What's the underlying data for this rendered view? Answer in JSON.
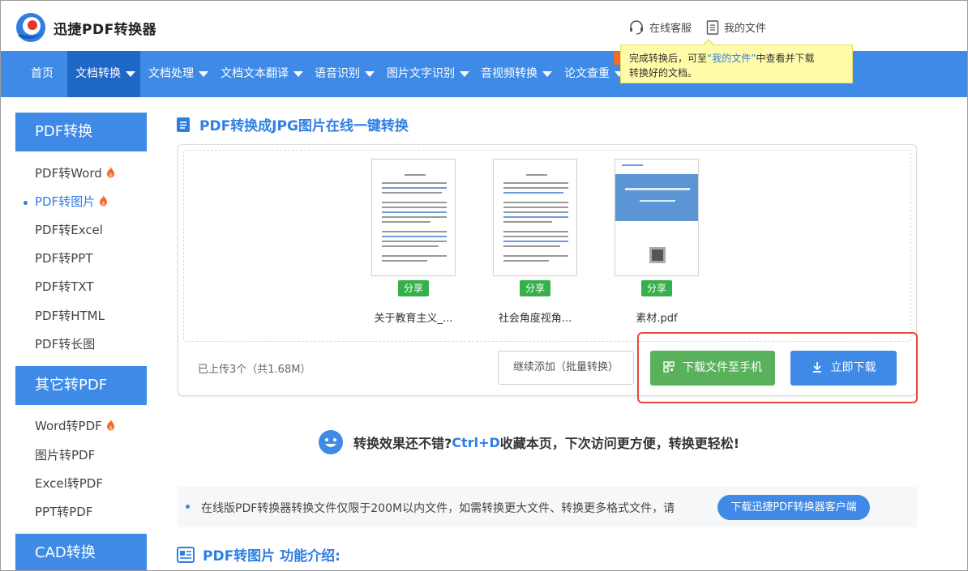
{
  "header": {
    "logo_text": "迅捷PDF转换器",
    "service_label": "在线客服",
    "files_label": "我的文件"
  },
  "nav": {
    "items": [
      {
        "label": "首页"
      },
      {
        "label": "文档转换"
      },
      {
        "label": "文档处理"
      },
      {
        "label": "文档文本翻译"
      },
      {
        "label": "语音识别"
      },
      {
        "label": "图片文字识别"
      },
      {
        "label": "音视频转换"
      },
      {
        "label": "论文查重"
      }
    ]
  },
  "tooltip": {
    "line1_a": "完成转换后，可至",
    "line1_link": "“我的文件”",
    "line1_b": "中查看并下载",
    "line2": "转换好的文档。"
  },
  "sidebar": {
    "sections": [
      {
        "title": "PDF转换",
        "items": [
          "PDF转Word",
          "PDF转图片",
          "PDF转Excel",
          "PDF转PPT",
          "PDF转TXT",
          "PDF转HTML",
          "PDF转长图"
        ]
      },
      {
        "title": "其它转PDF",
        "items": [
          "Word转PDF",
          "图片转PDF",
          "Excel转PDF",
          "PPT转PDF"
        ]
      },
      {
        "title": "CAD转换",
        "items": []
      }
    ]
  },
  "main": {
    "title": "PDF转换成JPG图片在线一键转换",
    "files": [
      {
        "name": "关于教育主义_...",
        "share_label": "分享"
      },
      {
        "name": "社会角度视角...",
        "share_label": "分享"
      },
      {
        "name": "素材.pdf",
        "share_label": "分享"
      }
    ],
    "upload_count": "已上传3个（共1.68M）",
    "add_more_label": "继续添加（批量转换）",
    "download_phone_label": "下载文件至手机",
    "download_now_label": "立即下载",
    "promo": {
      "text_a": "转换效果还不错?",
      "ctrl": "Ctrl+D",
      "text_b": "收藏本页，下次访问更方便，转换更轻松!"
    },
    "notice": {
      "text": "在线版PDF转换器转换文件仅限于200M以内文件，如需转换更大文件、转换更多格式文件，请",
      "button": "下载迅捷PDF转换器客户端"
    },
    "intro_title": "PDF转图片 功能介绍:"
  },
  "colors": {
    "primary": "#3e8ae6",
    "primary_dark": "#1f67c4",
    "green": "#5ab15c",
    "share_green": "#36b04a",
    "highlight_red": "#e24a3d",
    "tooltip_bg": "#fffba8"
  }
}
